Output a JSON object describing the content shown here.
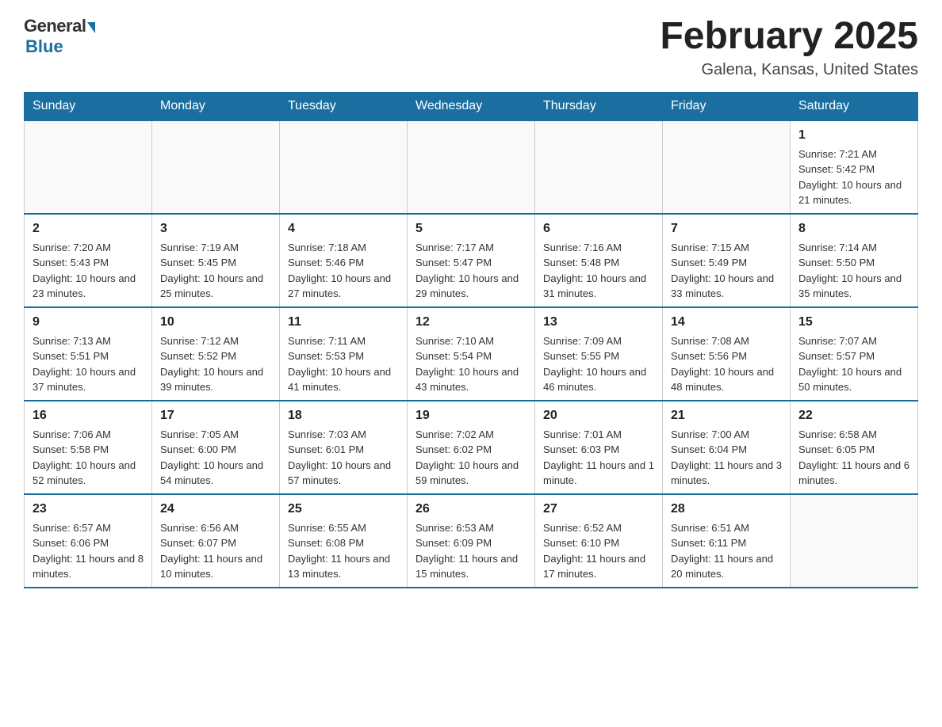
{
  "header": {
    "logo_general": "General",
    "logo_blue": "Blue",
    "month_title": "February 2025",
    "location": "Galena, Kansas, United States"
  },
  "days_of_week": [
    "Sunday",
    "Monday",
    "Tuesday",
    "Wednesday",
    "Thursday",
    "Friday",
    "Saturday"
  ],
  "weeks": [
    [
      {
        "day": "",
        "info": ""
      },
      {
        "day": "",
        "info": ""
      },
      {
        "day": "",
        "info": ""
      },
      {
        "day": "",
        "info": ""
      },
      {
        "day": "",
        "info": ""
      },
      {
        "day": "",
        "info": ""
      },
      {
        "day": "1",
        "info": "Sunrise: 7:21 AM\nSunset: 5:42 PM\nDaylight: 10 hours and 21 minutes."
      }
    ],
    [
      {
        "day": "2",
        "info": "Sunrise: 7:20 AM\nSunset: 5:43 PM\nDaylight: 10 hours and 23 minutes."
      },
      {
        "day": "3",
        "info": "Sunrise: 7:19 AM\nSunset: 5:45 PM\nDaylight: 10 hours and 25 minutes."
      },
      {
        "day": "4",
        "info": "Sunrise: 7:18 AM\nSunset: 5:46 PM\nDaylight: 10 hours and 27 minutes."
      },
      {
        "day": "5",
        "info": "Sunrise: 7:17 AM\nSunset: 5:47 PM\nDaylight: 10 hours and 29 minutes."
      },
      {
        "day": "6",
        "info": "Sunrise: 7:16 AM\nSunset: 5:48 PM\nDaylight: 10 hours and 31 minutes."
      },
      {
        "day": "7",
        "info": "Sunrise: 7:15 AM\nSunset: 5:49 PM\nDaylight: 10 hours and 33 minutes."
      },
      {
        "day": "8",
        "info": "Sunrise: 7:14 AM\nSunset: 5:50 PM\nDaylight: 10 hours and 35 minutes."
      }
    ],
    [
      {
        "day": "9",
        "info": "Sunrise: 7:13 AM\nSunset: 5:51 PM\nDaylight: 10 hours and 37 minutes."
      },
      {
        "day": "10",
        "info": "Sunrise: 7:12 AM\nSunset: 5:52 PM\nDaylight: 10 hours and 39 minutes."
      },
      {
        "day": "11",
        "info": "Sunrise: 7:11 AM\nSunset: 5:53 PM\nDaylight: 10 hours and 41 minutes."
      },
      {
        "day": "12",
        "info": "Sunrise: 7:10 AM\nSunset: 5:54 PM\nDaylight: 10 hours and 43 minutes."
      },
      {
        "day": "13",
        "info": "Sunrise: 7:09 AM\nSunset: 5:55 PM\nDaylight: 10 hours and 46 minutes."
      },
      {
        "day": "14",
        "info": "Sunrise: 7:08 AM\nSunset: 5:56 PM\nDaylight: 10 hours and 48 minutes."
      },
      {
        "day": "15",
        "info": "Sunrise: 7:07 AM\nSunset: 5:57 PM\nDaylight: 10 hours and 50 minutes."
      }
    ],
    [
      {
        "day": "16",
        "info": "Sunrise: 7:06 AM\nSunset: 5:58 PM\nDaylight: 10 hours and 52 minutes."
      },
      {
        "day": "17",
        "info": "Sunrise: 7:05 AM\nSunset: 6:00 PM\nDaylight: 10 hours and 54 minutes."
      },
      {
        "day": "18",
        "info": "Sunrise: 7:03 AM\nSunset: 6:01 PM\nDaylight: 10 hours and 57 minutes."
      },
      {
        "day": "19",
        "info": "Sunrise: 7:02 AM\nSunset: 6:02 PM\nDaylight: 10 hours and 59 minutes."
      },
      {
        "day": "20",
        "info": "Sunrise: 7:01 AM\nSunset: 6:03 PM\nDaylight: 11 hours and 1 minute."
      },
      {
        "day": "21",
        "info": "Sunrise: 7:00 AM\nSunset: 6:04 PM\nDaylight: 11 hours and 3 minutes."
      },
      {
        "day": "22",
        "info": "Sunrise: 6:58 AM\nSunset: 6:05 PM\nDaylight: 11 hours and 6 minutes."
      }
    ],
    [
      {
        "day": "23",
        "info": "Sunrise: 6:57 AM\nSunset: 6:06 PM\nDaylight: 11 hours and 8 minutes."
      },
      {
        "day": "24",
        "info": "Sunrise: 6:56 AM\nSunset: 6:07 PM\nDaylight: 11 hours and 10 minutes."
      },
      {
        "day": "25",
        "info": "Sunrise: 6:55 AM\nSunset: 6:08 PM\nDaylight: 11 hours and 13 minutes."
      },
      {
        "day": "26",
        "info": "Sunrise: 6:53 AM\nSunset: 6:09 PM\nDaylight: 11 hours and 15 minutes."
      },
      {
        "day": "27",
        "info": "Sunrise: 6:52 AM\nSunset: 6:10 PM\nDaylight: 11 hours and 17 minutes."
      },
      {
        "day": "28",
        "info": "Sunrise: 6:51 AM\nSunset: 6:11 PM\nDaylight: 11 hours and 20 minutes."
      },
      {
        "day": "",
        "info": ""
      }
    ]
  ]
}
